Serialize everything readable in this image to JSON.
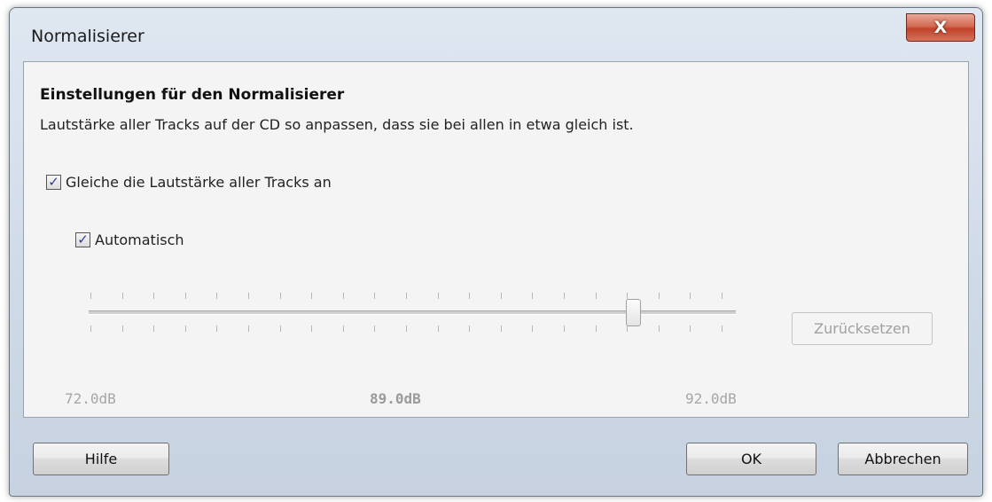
{
  "window": {
    "title": "Normalisierer",
    "close_label": "X"
  },
  "content": {
    "heading": "Einstellungen für den Normalisierer",
    "description": "Lautstärke aller Tracks auf der CD so anpassen, dass sie bei allen in etwa gleich ist."
  },
  "options": {
    "equalize": {
      "label": "Gleiche die Lautstärke aller Tracks an",
      "checked": true,
      "mark": "✓"
    },
    "automatic": {
      "label": "Automatisch",
      "checked": true,
      "mark": "✓"
    }
  },
  "slider": {
    "min_label": "72.0dB",
    "current_label": "89.0dB",
    "max_label": "92.0dB",
    "disabled": true
  },
  "buttons": {
    "reset": "Zurücksetzen",
    "help": "Hilfe",
    "ok": "OK",
    "cancel": "Abbrechen"
  },
  "colors": {
    "close_button": "#c1432a",
    "checkmark": "#2d3f9c",
    "disabled_text": "#a6a6a6"
  }
}
